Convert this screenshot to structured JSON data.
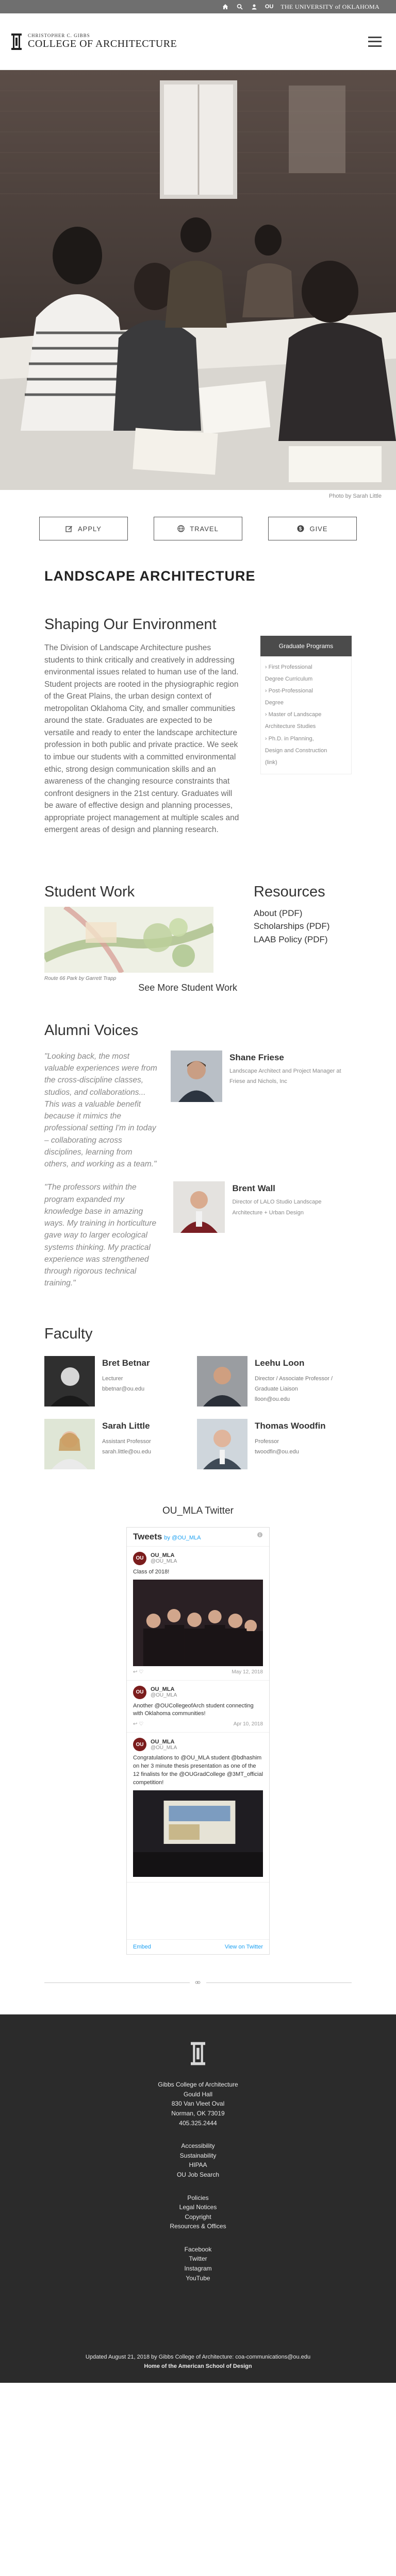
{
  "topbar": {
    "home_icon": "home-icon",
    "search_icon": "search-icon",
    "user_icon": "user-icon",
    "ou_mark": "OU",
    "university_text": "THE UNIVERSITY of OKLAHOMA"
  },
  "header": {
    "logo_small": "CHRISTOPHER C. GIBBS",
    "logo_big": "COLLEGE OF ARCHITECTURE"
  },
  "hero": {
    "credit": "Photo by Sarah Little"
  },
  "ctas": [
    {
      "label": "APPLY",
      "icon": "edit-icon"
    },
    {
      "label": "TRAVEL",
      "icon": "globe-icon"
    },
    {
      "label": "GIVE",
      "icon": "dollar-icon"
    }
  ],
  "program_title": "LANDSCAPE ARCHITECTURE",
  "intro": {
    "title": "Shaping Our Environment",
    "body": "The Division of Landscape Architecture pushes students to think critically and creatively in addressing environmental issues related to human use of the land. Student projects are rooted in the physiographic region of the Great Plains, the urban design context of metropolitan Oklahoma City, and smaller communities around the state. Graduates are expected to be versatile and ready to enter the landscape architecture profession in both public and private practice. We seek to imbue our students with a committed environmental ethic, strong design communication skills and an awareness of the changing resource constraints that confront designers in the 21st century. Graduates will be aware of effective design and planning processes, appropriate project management at multiple scales and emergent areas of design and planning research."
  },
  "sidebar": {
    "button": "Graduate Programs",
    "items": [
      "› First Professional",
      "Degree Curriculum",
      "› Post-Professional",
      "Degree",
      "› Master of Landscape",
      "Architecture Studies",
      "› Ph.D. in Planning,",
      "Design and Construction",
      "(link)"
    ]
  },
  "student_work": {
    "title": "Student Work",
    "caption": "Route 66 Park by Garrett Trapp",
    "more": "See More Student Work"
  },
  "resources": {
    "title": "Resources",
    "items": [
      "About (PDF)",
      "Scholarships (PDF)",
      "LAAB Policy (PDF)"
    ]
  },
  "alumni": {
    "title": "Alumni Voices",
    "entries": [
      {
        "quote": "\"Looking back, the most valuable experiences were from the cross-discipline classes, studios, and collaborations... This was a valuable benefit because it mimics the professional setting I'm in today – collaborating across disciplines, learning from others, and working as a team.\"",
        "name": "Shane Friese",
        "role": "Landscape Architect and Project Manager at Friese and Nichols, Inc"
      },
      {
        "quote": "\"The professors within the program expanded my knowledge base in amazing ways. My training in horticulture gave way to larger ecological systems thinking. My practical experience was strengthened through rigorous technical training.\"",
        "name": "Brent Wall",
        "role": "Director of LALO Studio Landscape Architecture + Urban Design"
      }
    ]
  },
  "faculty": {
    "title": "Faculty",
    "people": [
      {
        "name": "Bret Betnar",
        "title": "Lecturer",
        "email": "bbetnar@ou.edu"
      },
      {
        "name": "Leehu Loon",
        "title": "Director / Associate Professor / Graduate Liaison",
        "email": "lloon@ou.edu"
      },
      {
        "name": "Sarah Little",
        "title": "Assistant Professor",
        "email": "sarah.little@ou.edu"
      },
      {
        "name": "Thomas Woodfin",
        "title": "Professor",
        "email": "twoodfin@ou.edu"
      }
    ]
  },
  "twitter": {
    "heading": "OU_MLA Twitter",
    "widget_title": "Tweets",
    "widget_by": "by @OU_MLA",
    "tweets": [
      {
        "name": "OU_MLA",
        "handle": "@OU_MLA",
        "body": "Class of 2018!",
        "date": "May 12, 2018"
      },
      {
        "name": "OU_MLA",
        "handle": "@OU_MLA",
        "body": "Another @OUCollegeofArch student connecting with Oklahoma communities!",
        "date": "Apr 10, 2018"
      },
      {
        "name": "OU_MLA",
        "handle": "@OU_MLA",
        "body": "Congratulations to @OU_MLA student @bdhashim on her 3 minute thesis presentation as one of the 12 finalists for the @OUGradCollege @3MT_official competition!",
        "date": ""
      }
    ],
    "embed_label": "Embed",
    "view_label": "View on Twitter"
  },
  "footer": {
    "address": [
      "Gibbs College of Architecture",
      "Gould Hall",
      "830 Van Vleet Oval",
      "Norman, OK 73019",
      "405.325.2444"
    ],
    "links1": [
      "Accessibility",
      "Sustainability",
      "HIPAA",
      "OU Job Search"
    ],
    "links2": [
      "Policies",
      "Legal Notices",
      "Copyright",
      "Resources & Offices"
    ],
    "social": [
      "Facebook",
      "Twitter",
      "Instagram",
      "YouTube"
    ],
    "updated": "Updated August 21, 2018 by Gibbs College of Architecture: coa-communications@ou.edu",
    "tagline": "Home of the American School of Design"
  }
}
